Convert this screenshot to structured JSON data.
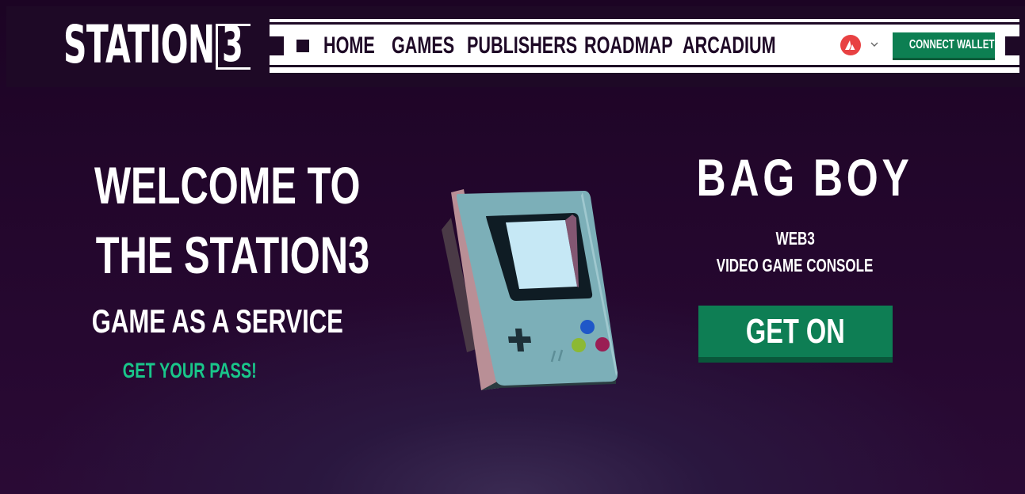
{
  "header": {
    "logo_text": "STATION",
    "logo_digit": "3",
    "nav": [
      "HOME",
      "GAMES",
      "PUBLISHERS",
      "ROADMAP",
      "ARCADIUM"
    ],
    "network_icon": "avalanche-logo",
    "connect_label": "CONNECT WALLET"
  },
  "hero": {
    "title_line1": "WELCOME TO",
    "title_line2": "THE STATION3",
    "subtitle": "GAME AS A SERVICE",
    "cta": "GET YOUR PASS!"
  },
  "product": {
    "name": "BAG BOY",
    "line1": "WEB3",
    "line2": "VIDEO GAME CONSOLE",
    "cta": "GET ON"
  },
  "colors": {
    "accent_green": "#0e7e54",
    "pass_green": "#19c68a",
    "avalanche_red": "#e84142",
    "background": "#22062b"
  }
}
